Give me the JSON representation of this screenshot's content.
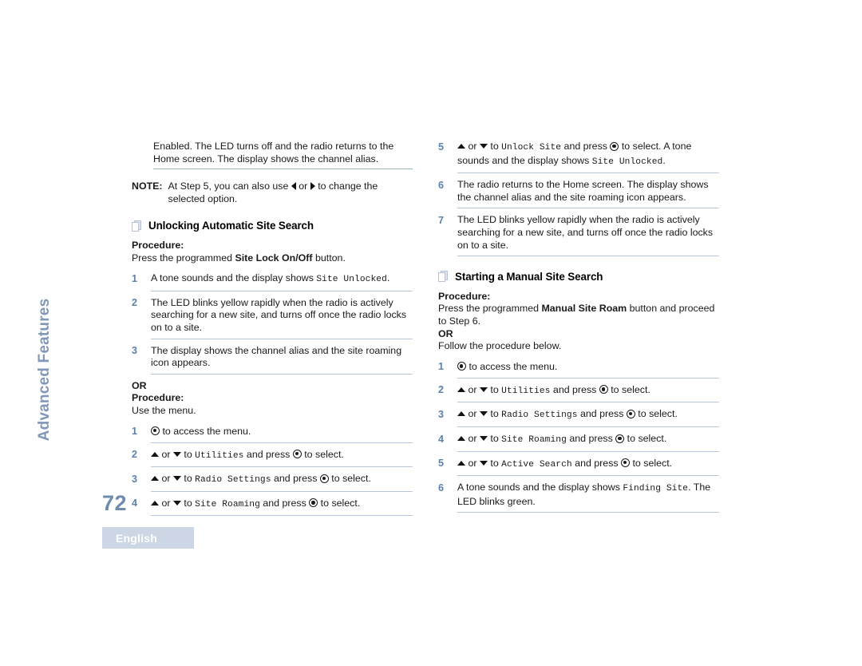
{
  "page": {
    "number": "72",
    "language_tab": "English",
    "chapter_tab": "Advanced Features"
  },
  "glyphs": {
    "menu_button": "menu-ok-button",
    "up": "triangle-up",
    "down": "triangle-down",
    "left": "triangle-left",
    "right": "triangle-right",
    "heading_bullet": "stacked-pages-icon"
  },
  "left_column": {
    "continuation": {
      "text": "Enabled. The LED turns off and the radio returns to the Home screen. The display shows the channel alias."
    },
    "note": {
      "label": "NOTE:",
      "text_before_left": "At Step 5, you can also use ",
      "text_between": " or ",
      "text_after_right": " to change the selected option."
    },
    "section": {
      "title": "Unlocking Automatic Site Search",
      "procedure_label": "Procedure:",
      "procedure_prefix": "Press the programmed ",
      "procedure_bold": "Site Lock On/Off",
      "procedure_suffix": " button.",
      "steps": [
        {
          "num": "1",
          "prefix": "A tone sounds and the display shows ",
          "mono": "Site Unlocked",
          "suffix": "."
        },
        {
          "num": "2",
          "prefix": "The LED blinks yellow rapidly when the radio is actively searching for a new site, and turns off once the radio locks on to a site.",
          "mono": "",
          "suffix": ""
        },
        {
          "num": "3",
          "prefix": "The display shows the channel alias and the site roaming icon appears.",
          "mono": "",
          "suffix": ""
        }
      ],
      "or_label": "OR",
      "procedure2_label": "Procedure:",
      "procedure2_text": "Use the menu.",
      "menu_steps": [
        {
          "num": "1",
          "lead": "button",
          "text_after_button": " to access the menu.",
          "mono": "",
          "text_tail": ""
        },
        {
          "num": "2",
          "lead": "arrows",
          "text_after_arrows": " to ",
          "mono": "Utilities",
          "text_mid": " and press ",
          "text_tail": " to select."
        },
        {
          "num": "3",
          "lead": "arrows",
          "text_after_arrows": " to ",
          "mono": "Radio Settings",
          "text_mid": " and press ",
          "text_tail": " to select."
        },
        {
          "num": "4",
          "lead": "arrows",
          "text_after_arrows": " to ",
          "mono": "Site Roaming",
          "text_mid": " and press ",
          "text_tail": " to select."
        }
      ],
      "or_word": "or"
    }
  },
  "right_column": {
    "continued_steps": [
      {
        "num": "5",
        "lead": "arrows",
        "text_after_arrows": " to ",
        "mono": "Unlock Site",
        "text_mid": " and press ",
        "text_tail": " to select. A tone sounds and the display shows ",
        "mono2": "Site Unlocked",
        "text_end": "."
      },
      {
        "num": "6",
        "lead": "plain",
        "text": "The radio returns to the Home screen. The display shows the channel alias and the site roaming icon appears."
      },
      {
        "num": "7",
        "lead": "plain",
        "text": "The LED blinks yellow rapidly when the radio is actively searching for a new site, and turns off once the radio locks on to a site."
      }
    ],
    "section": {
      "title": "Starting a Manual Site Search",
      "procedure_label": "Procedure:",
      "procedure_prefix": "Press the programmed ",
      "procedure_bold": "Manual Site Roam",
      "procedure_suffix": " button and proceed to Step 6.",
      "or_label": "OR",
      "follow_text": "Follow the procedure below.",
      "steps": [
        {
          "num": "1",
          "lead": "button",
          "text_after_button": " to access the menu.",
          "mono": "",
          "text_tail": ""
        },
        {
          "num": "2",
          "lead": "arrows",
          "text_after_arrows": " to ",
          "mono": "Utilities",
          "text_mid": " and press ",
          "text_tail": " to select."
        },
        {
          "num": "3",
          "lead": "arrows",
          "text_after_arrows": " to ",
          "mono": "Radio Settings",
          "text_mid": " and press ",
          "text_tail": " to select."
        },
        {
          "num": "4",
          "lead": "arrows",
          "text_after_arrows": " to ",
          "mono": "Site Roaming",
          "text_mid": " and press ",
          "text_tail": " to select."
        },
        {
          "num": "5",
          "lead": "arrows",
          "text_after_arrows": " to ",
          "mono": "Active Search",
          "text_mid": " and press ",
          "text_tail": " to select."
        },
        {
          "num": "6",
          "lead": "plain-mono",
          "prefix": "A tone sounds and the display shows ",
          "mono": "Finding Site",
          "suffix": ". The LED blinks green."
        }
      ],
      "or_word": "or"
    }
  },
  "colors": {
    "step_number": "#5e81ab",
    "step_rule": "#b9c5db",
    "teal_rule": "#96b6b2",
    "tab_text": "#8097b7",
    "lang_box_bg": "#ccd6e5",
    "page_number": "#6f8cb0",
    "heading_icon": "#b6c3d7"
  }
}
